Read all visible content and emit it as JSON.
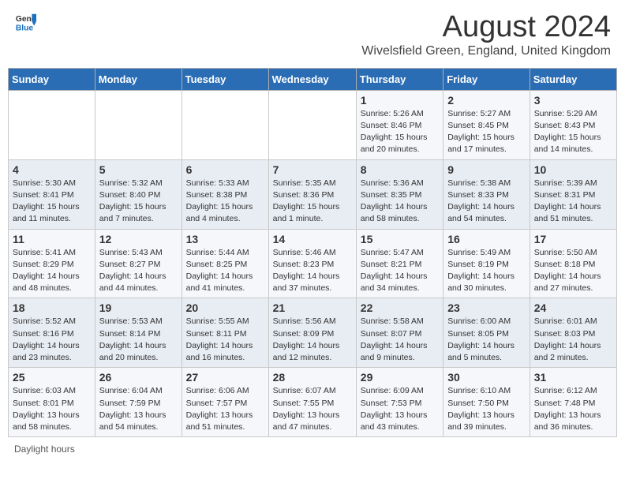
{
  "header": {
    "logo_general": "General",
    "logo_blue": "Blue",
    "main_title": "August 2024",
    "subtitle": "Wivelsfield Green, England, United Kingdom"
  },
  "days_of_week": [
    "Sunday",
    "Monday",
    "Tuesday",
    "Wednesday",
    "Thursday",
    "Friday",
    "Saturday"
  ],
  "weeks": [
    [
      {
        "day": "",
        "info": ""
      },
      {
        "day": "",
        "info": ""
      },
      {
        "day": "",
        "info": ""
      },
      {
        "day": "",
        "info": ""
      },
      {
        "day": "1",
        "info": "Sunrise: 5:26 AM\nSunset: 8:46 PM\nDaylight: 15 hours\nand 20 minutes."
      },
      {
        "day": "2",
        "info": "Sunrise: 5:27 AM\nSunset: 8:45 PM\nDaylight: 15 hours\nand 17 minutes."
      },
      {
        "day": "3",
        "info": "Sunrise: 5:29 AM\nSunset: 8:43 PM\nDaylight: 15 hours\nand 14 minutes."
      }
    ],
    [
      {
        "day": "4",
        "info": "Sunrise: 5:30 AM\nSunset: 8:41 PM\nDaylight: 15 hours\nand 11 minutes."
      },
      {
        "day": "5",
        "info": "Sunrise: 5:32 AM\nSunset: 8:40 PM\nDaylight: 15 hours\nand 7 minutes."
      },
      {
        "day": "6",
        "info": "Sunrise: 5:33 AM\nSunset: 8:38 PM\nDaylight: 15 hours\nand 4 minutes."
      },
      {
        "day": "7",
        "info": "Sunrise: 5:35 AM\nSunset: 8:36 PM\nDaylight: 15 hours\nand 1 minute."
      },
      {
        "day": "8",
        "info": "Sunrise: 5:36 AM\nSunset: 8:35 PM\nDaylight: 14 hours\nand 58 minutes."
      },
      {
        "day": "9",
        "info": "Sunrise: 5:38 AM\nSunset: 8:33 PM\nDaylight: 14 hours\nand 54 minutes."
      },
      {
        "day": "10",
        "info": "Sunrise: 5:39 AM\nSunset: 8:31 PM\nDaylight: 14 hours\nand 51 minutes."
      }
    ],
    [
      {
        "day": "11",
        "info": "Sunrise: 5:41 AM\nSunset: 8:29 PM\nDaylight: 14 hours\nand 48 minutes."
      },
      {
        "day": "12",
        "info": "Sunrise: 5:43 AM\nSunset: 8:27 PM\nDaylight: 14 hours\nand 44 minutes."
      },
      {
        "day": "13",
        "info": "Sunrise: 5:44 AM\nSunset: 8:25 PM\nDaylight: 14 hours\nand 41 minutes."
      },
      {
        "day": "14",
        "info": "Sunrise: 5:46 AM\nSunset: 8:23 PM\nDaylight: 14 hours\nand 37 minutes."
      },
      {
        "day": "15",
        "info": "Sunrise: 5:47 AM\nSunset: 8:21 PM\nDaylight: 14 hours\nand 34 minutes."
      },
      {
        "day": "16",
        "info": "Sunrise: 5:49 AM\nSunset: 8:19 PM\nDaylight: 14 hours\nand 30 minutes."
      },
      {
        "day": "17",
        "info": "Sunrise: 5:50 AM\nSunset: 8:18 PM\nDaylight: 14 hours\nand 27 minutes."
      }
    ],
    [
      {
        "day": "18",
        "info": "Sunrise: 5:52 AM\nSunset: 8:16 PM\nDaylight: 14 hours\nand 23 minutes."
      },
      {
        "day": "19",
        "info": "Sunrise: 5:53 AM\nSunset: 8:14 PM\nDaylight: 14 hours\nand 20 minutes."
      },
      {
        "day": "20",
        "info": "Sunrise: 5:55 AM\nSunset: 8:11 PM\nDaylight: 14 hours\nand 16 minutes."
      },
      {
        "day": "21",
        "info": "Sunrise: 5:56 AM\nSunset: 8:09 PM\nDaylight: 14 hours\nand 12 minutes."
      },
      {
        "day": "22",
        "info": "Sunrise: 5:58 AM\nSunset: 8:07 PM\nDaylight: 14 hours\nand 9 minutes."
      },
      {
        "day": "23",
        "info": "Sunrise: 6:00 AM\nSunset: 8:05 PM\nDaylight: 14 hours\nand 5 minutes."
      },
      {
        "day": "24",
        "info": "Sunrise: 6:01 AM\nSunset: 8:03 PM\nDaylight: 14 hours\nand 2 minutes."
      }
    ],
    [
      {
        "day": "25",
        "info": "Sunrise: 6:03 AM\nSunset: 8:01 PM\nDaylight: 13 hours\nand 58 minutes."
      },
      {
        "day": "26",
        "info": "Sunrise: 6:04 AM\nSunset: 7:59 PM\nDaylight: 13 hours\nand 54 minutes."
      },
      {
        "day": "27",
        "info": "Sunrise: 6:06 AM\nSunset: 7:57 PM\nDaylight: 13 hours\nand 51 minutes."
      },
      {
        "day": "28",
        "info": "Sunrise: 6:07 AM\nSunset: 7:55 PM\nDaylight: 13 hours\nand 47 minutes."
      },
      {
        "day": "29",
        "info": "Sunrise: 6:09 AM\nSunset: 7:53 PM\nDaylight: 13 hours\nand 43 minutes."
      },
      {
        "day": "30",
        "info": "Sunrise: 6:10 AM\nSunset: 7:50 PM\nDaylight: 13 hours\nand 39 minutes."
      },
      {
        "day": "31",
        "info": "Sunrise: 6:12 AM\nSunset: 7:48 PM\nDaylight: 13 hours\nand 36 minutes."
      }
    ]
  ],
  "footer": {
    "daylight_label": "Daylight hours"
  }
}
